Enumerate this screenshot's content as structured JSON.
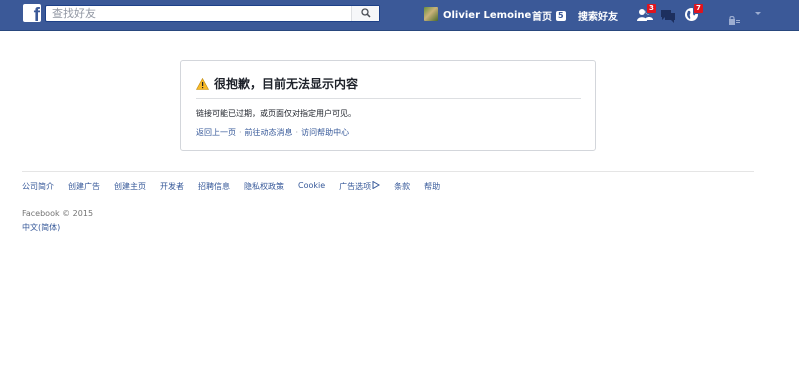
{
  "header": {
    "logo": "f",
    "search_placeholder": "查找好友",
    "user_name": "Olivier Lemoine",
    "home_label": "首页",
    "home_count": "5",
    "find_friends_label": "搜索好友",
    "friend_requests_count": "3",
    "notifications_count": "7",
    "icons": [
      "facebook-logo",
      "search-icon",
      "friends-icon",
      "messages-icon",
      "globe-icon",
      "privacy-lock-icon",
      "chevron-down-icon"
    ]
  },
  "error": {
    "title": "很抱歉，目前无法显示内容",
    "message": "链接可能已过期，或页面仅对指定用户可见。",
    "links": [
      "返回上一页",
      "前往动态消息",
      "访问帮助中心"
    ],
    "separator": "·"
  },
  "footer": {
    "links": [
      "公司简介",
      "创建广告",
      "创建主页",
      "开发者",
      "招聘信息",
      "隐私权政策",
      "Cookie",
      "广告选项",
      "条款",
      "帮助"
    ],
    "copyright": "Facebook © 2015",
    "language": "中文(简体)"
  },
  "colors": {
    "brand_blue": "#3b5998",
    "link_blue": "#365899",
    "badge_red": "#e0141e",
    "warning_yellow": "#f7b928"
  }
}
